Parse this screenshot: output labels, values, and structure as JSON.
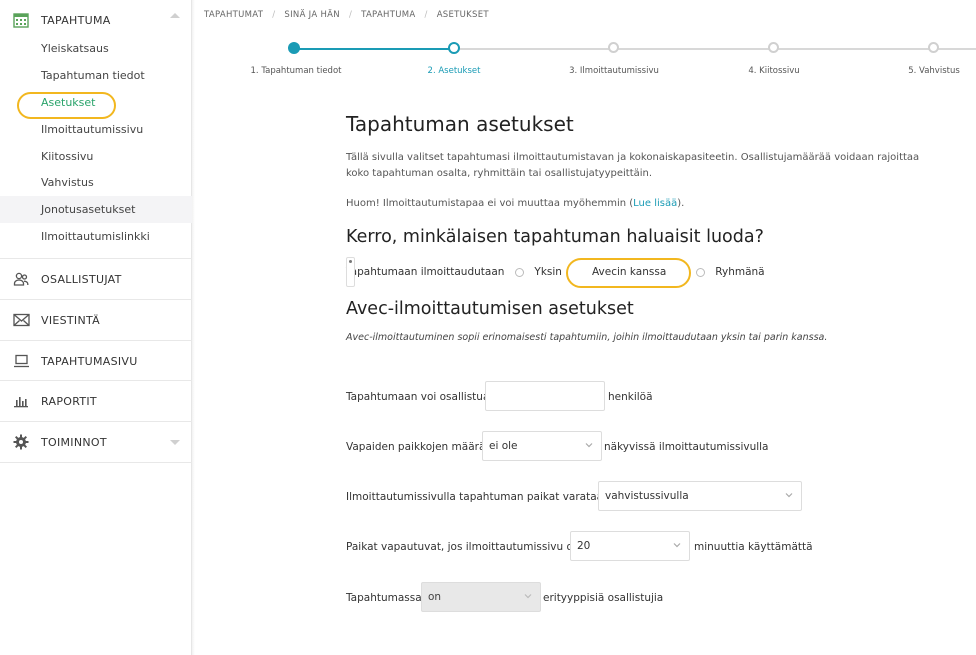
{
  "sidebar": {
    "event_section": {
      "label": "TAPAHTUMA"
    },
    "items": [
      {
        "label": "Yleiskatsaus"
      },
      {
        "label": "Tapahtuman tiedot"
      },
      {
        "label": "Asetukset"
      },
      {
        "label": "Ilmoittautumissivu"
      },
      {
        "label": "Kiitossivu"
      },
      {
        "label": "Vahvistus"
      },
      {
        "label": "Jonotusasetukset"
      },
      {
        "label": "Ilmoittautumislinkki"
      }
    ],
    "sections": [
      {
        "label": "OSALLISTUJAT",
        "icon": "participants-icon"
      },
      {
        "label": "VIESTINTÄ",
        "icon": "envelope-icon"
      },
      {
        "label": "TAPAHTUMASIVU",
        "icon": "laptop-icon"
      },
      {
        "label": "RAPORTIT",
        "icon": "bar-chart-icon"
      },
      {
        "label": "TOIMINNOT",
        "icon": "gear-icon"
      }
    ]
  },
  "breadcrumb": [
    "TAPAHTUMAT",
    "SINÄ JA HÄN",
    "TAPAHTUMA",
    "ASETUKSET"
  ],
  "stepper": {
    "steps": [
      "1. Tapahtuman tiedot",
      "2. Asetukset",
      "3. Ilmoittautumissivu",
      "4. Kiitossivu",
      "5. Vahvistus"
    ],
    "current_index": 1
  },
  "page": {
    "title": "Tapahtuman asetukset",
    "intro": "Tällä sivulla valitset tapahtumasi ilmoittautumistavan ja kokonaiskapasiteetin. Osallistujamäärää voidaan rajoittaa koko tapahtuman osalta, ryhmittäin tai osallistujatyypeittäin.",
    "note_prefix": "Huom! Ilmoittautumistapaa ei voi muuttaa myöhemmin (",
    "note_link": "Lue lisää",
    "note_suffix": ").",
    "question": "Kerro, minkälaisen tapahtuman haluaisit luoda?",
    "registration_label": "Tapahtumaan ilmoittaudutaan",
    "options": [
      "Yksin",
      "Avecin kanssa",
      "Ryhmänä"
    ],
    "selected_option": "Avecin kanssa",
    "avec_heading": "Avec-ilmoittautumisen asetukset",
    "avec_description": "Avec-ilmoittautuminen sopii erinomaisesti tapahtumiin, joihin ilmoittaudutaan yksin tai parin kanssa."
  },
  "form": {
    "capacity": {
      "label": "Tapahtumaan voi osallistua",
      "value": "",
      "suffix": "henkilöä"
    },
    "free_spots": {
      "label": "Vapaiden paikkojen määrä",
      "value": "ei ole",
      "suffix": "näkyvissä ilmoittautumissivulla"
    },
    "reserve": {
      "label": "Ilmoittautumissivulla tapahtuman paikat varataan",
      "value": "vahvistussivulla"
    },
    "release": {
      "label": "Paikat vapautuvat, jos ilmoittautumissivu on",
      "value": "20",
      "suffix": "minuuttia käyttämättä"
    },
    "types": {
      "label": "Tapahtumassa",
      "value": "on",
      "suffix": "erityyppisiä osallistujia"
    }
  },
  "colors": {
    "accent": "#1a9bb5",
    "active_green": "#29a36a",
    "highlight": "#f2b71f"
  }
}
